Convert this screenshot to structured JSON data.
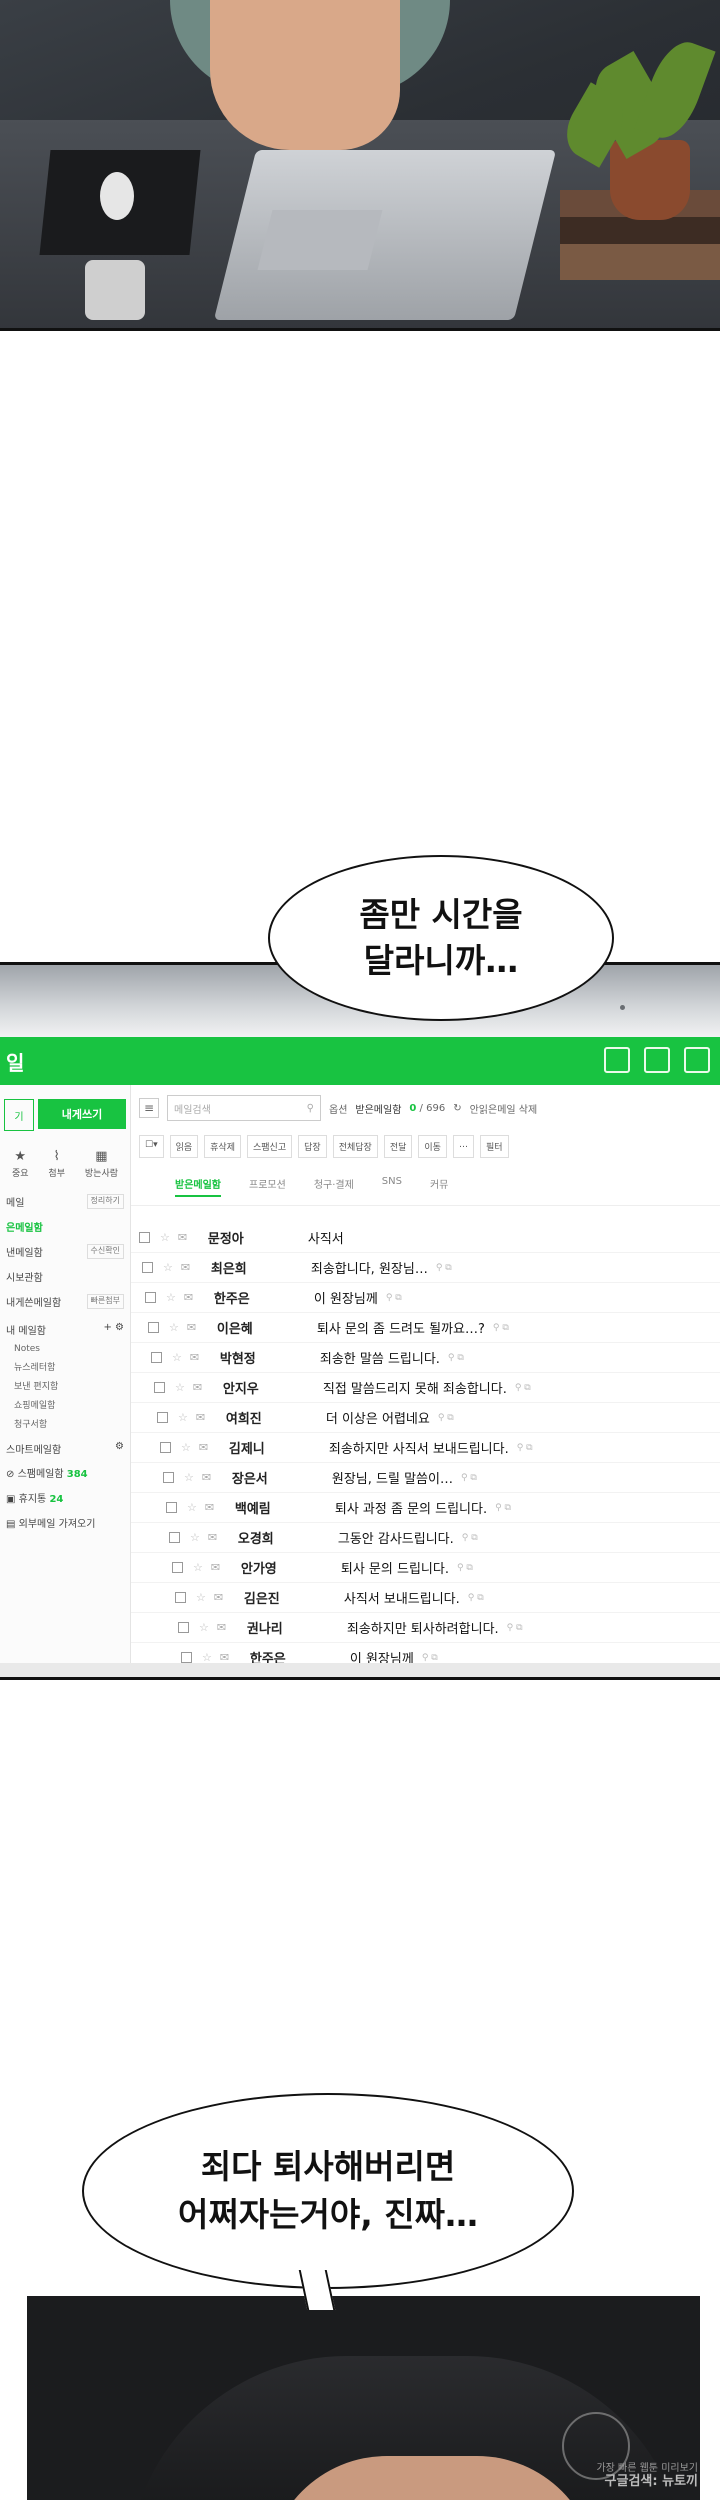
{
  "bubbles": {
    "first": "좀만 시간을\n달라니까…",
    "second": "죄다 퇴사해버리면\n어쩌자는거야, 진짜…"
  },
  "mail": {
    "app_title": "일",
    "accent_color": "#18c341",
    "sidebar": {
      "left_button": "기",
      "compose_button": "내게쓰기",
      "quick_actions": [
        {
          "icon": "star-icon",
          "label": "중요"
        },
        {
          "icon": "paperclip-icon",
          "label": "첨부"
        },
        {
          "icon": "calendar-icon",
          "label": "방는사람"
        }
      ],
      "folders": [
        {
          "label": "메일",
          "tag": "정리하기",
          "active": false
        },
        {
          "label": "은메일함",
          "tag": "",
          "active": true
        },
        {
          "label": "낸메일함",
          "tag": "수신확인",
          "active": false
        },
        {
          "label": "시보관함",
          "tag": "",
          "active": false
        },
        {
          "label": "내게쓴메일함",
          "tag": "빠른첨부",
          "active": false
        }
      ],
      "my_mailbox": "내 메일함",
      "subfolders": [
        "Notes",
        "뉴스레터함",
        "보낸 편지함",
        "쇼핑메일함",
        "청구서함"
      ],
      "smart_mailbox": "스마트메일함",
      "spam": {
        "label": "스팸메일함",
        "count": "384"
      },
      "trash": {
        "label": "휴지통",
        "count": "24"
      },
      "external": "외부메일 가져오기"
    },
    "search_placeholder": "메일검색",
    "search_option": "옵션",
    "mailbox_name": "받은메일함",
    "unread": "0",
    "total": "696",
    "unread_label": "안읽은메일 삭제",
    "toolbar": [
      "읽음",
      "휴삭제",
      "스팸신고",
      "답장",
      "전체답장",
      "전달",
      "이동",
      "…",
      "필터"
    ],
    "tabs": [
      "받은메일함",
      "프로모션",
      "청구·결제",
      "SNS",
      "커뮤"
    ],
    "rows": [
      {
        "sender": "문정아",
        "subject": "사직서",
        "meta": ""
      },
      {
        "sender": "최은희",
        "subject": "죄송합니다, 원장님…",
        "meta": "⚲ ⧉"
      },
      {
        "sender": "한주은",
        "subject": "이 원장님께",
        "meta": "⚲ ⧉"
      },
      {
        "sender": "이은혜",
        "subject": "퇴사 문의 좀 드려도 될까요…?",
        "meta": "⚲ ⧉"
      },
      {
        "sender": "박현정",
        "subject": "죄송한 말씀 드립니다.",
        "meta": "⚲ ⧉"
      },
      {
        "sender": "안지우",
        "subject": "직접 말씀드리지 못해 죄송합니다.",
        "meta": "⚲ ⧉"
      },
      {
        "sender": "여희진",
        "subject": "더 이상은 어렵네요",
        "meta": "⚲ ⧉"
      },
      {
        "sender": "김제니",
        "subject": "죄송하지만 사직서 보내드립니다.",
        "meta": "⚲ ⧉"
      },
      {
        "sender": "장은서",
        "subject": "원장님, 드릴 말씀이…",
        "meta": "⚲ ⧉"
      },
      {
        "sender": "백예림",
        "subject": "퇴사 과정 좀 문의 드립니다.",
        "meta": "⚲ ⧉"
      },
      {
        "sender": "오경희",
        "subject": "그동안 감사드립니다.",
        "meta": "⚲ ⧉"
      },
      {
        "sender": "안가영",
        "subject": "퇴사 문의 드립니다.",
        "meta": "⚲ ⧉"
      },
      {
        "sender": "김은진",
        "subject": "사직서 보내드립니다.",
        "meta": "⚲ ⧉"
      },
      {
        "sender": "권나리",
        "subject": "죄송하지만 퇴사하려합니다.",
        "meta": "⚲ ⧉"
      },
      {
        "sender": "한주은",
        "subject": "이 원장님께",
        "meta": "⚲ ⧉"
      }
    ]
  },
  "watermark": {
    "line1": "가장 빠른 웹툰 미리보기",
    "line2": "구글검색: 뉴토끼"
  }
}
